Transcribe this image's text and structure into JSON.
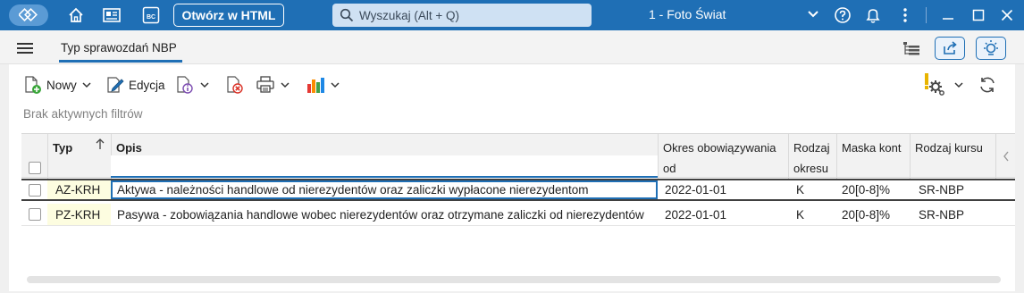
{
  "titlebar": {
    "open_html_label": "Otwórz w HTML",
    "search_placeholder": "Wyszukaj (Alt + Q)",
    "company": "1 - Foto Świat",
    "bc_label": "BC"
  },
  "tabs": [
    {
      "label": "Typ sprawozdań NBP",
      "active": true
    }
  ],
  "toolbar": {
    "new_label": "Nowy",
    "edit_label": "Edycja"
  },
  "filters_text": "Brak aktywnych filtrów",
  "grid": {
    "columns": [
      {
        "label": "Typ"
      },
      {
        "label": "Opis"
      },
      {
        "label_line1": "Okres obowiązywania",
        "label_line2": "od"
      },
      {
        "label_line1": "Rodzaj",
        "label_line2": "okresu"
      },
      {
        "label": "Maska kont"
      },
      {
        "label": "Rodzaj kursu"
      }
    ],
    "rows": [
      {
        "typ": "AZ-KRH",
        "opis": "Aktywa - należności handlowe od nierezydentów oraz zaliczki wypłacone nierezydentom",
        "okres_od": "2022-01-01",
        "rodzaj_okresu": "K",
        "maska_kont": "20[0-8]%",
        "rodzaj_kursu": "SR-NBP"
      },
      {
        "typ": "PZ-KRH",
        "opis": "Pasywa - zobowiązania handlowe wobec nierezydentów oraz otrzymane zaliczki od nierezydentów",
        "okres_od": "2022-01-01",
        "rodzaj_okresu": "K",
        "maska_kont": "20[0-8]%",
        "rodzaj_kursu": "SR-NBP"
      }
    ]
  },
  "colors": {
    "accent": "#1f6fb5",
    "typ_cell_bg": "#fdfde0",
    "warning": "#e8b400"
  }
}
